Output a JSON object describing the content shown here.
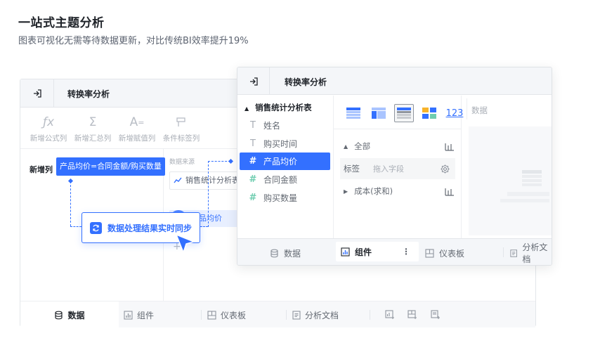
{
  "hero": {
    "title": "一站式主题分析",
    "subtitle": "图表可视化无需等待数据更新，对比传统BI效率提升19%"
  },
  "back_window": {
    "title": "转换率分析",
    "toolbar": [
      {
        "label": "新增公式列",
        "icon": "fx-icon"
      },
      {
        "label": "新增汇总列",
        "icon": "sigma-icon"
      },
      {
        "label": "新增赋值列",
        "icon": "assign-icon"
      },
      {
        "label": "条件标签列",
        "icon": "tag-flag-icon"
      }
    ],
    "new_column_label": "新增列",
    "formula_chip": "产品均价=合同金额/购买数量",
    "source_label": "数据来源",
    "source_table": "销售统计分析表",
    "product_price_chip": "品均价",
    "add_symbol": "+",
    "footer_tabs": [
      {
        "label": "数据",
        "active": true
      },
      {
        "label": "组件",
        "active": false
      },
      {
        "label": "仪表板",
        "active": false
      },
      {
        "label": "分析文档",
        "active": false
      }
    ]
  },
  "sync_badge": {
    "text": "数据处理结果实时同步"
  },
  "front_window": {
    "title": "转换率分析",
    "table_name": "销售统计分析表",
    "fields": [
      {
        "label": "姓名",
        "type": "text",
        "active": false
      },
      {
        "label": "购买时间",
        "type": "text",
        "active": false
      },
      {
        "label": "产品均价",
        "type": "number",
        "active": true
      },
      {
        "label": "合同金额",
        "type": "number",
        "active": false
      },
      {
        "label": "购买数量",
        "type": "number",
        "active": false
      }
    ],
    "number_type_label": "123",
    "config": {
      "all_label": "全部",
      "tag_label": "标签",
      "tag_placeholder": "拖入字段",
      "cost_label": "成本(求和)"
    },
    "canvas_label": "数据",
    "footer_tabs": [
      {
        "label": "数据",
        "active": false
      },
      {
        "label": "组件",
        "active": true
      },
      {
        "label": "仪表板",
        "active": false
      },
      {
        "label": "分析文档",
        "active": false
      }
    ],
    "more_symbol": "⋮"
  },
  "colors": {
    "accent": "#3370ff",
    "number_field": "#6fcdb0",
    "header_bg": "#f4f6f9"
  }
}
